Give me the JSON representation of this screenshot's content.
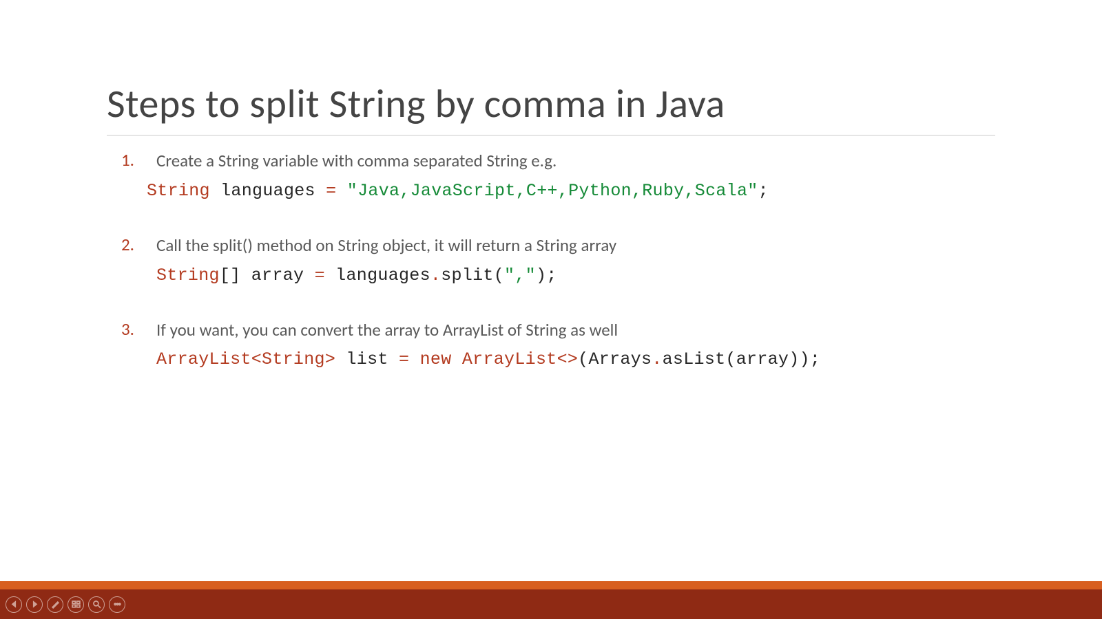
{
  "slide": {
    "title": "Steps to split String by comma in Java",
    "steps": [
      {
        "num": "1.",
        "text": "Create a String variable with comma separated String e.g.",
        "code": {
          "seg1_type": "String",
          "seg2_plain": " languages ",
          "seg3_op": "=",
          "seg4_plain": " ",
          "seg5_str": "\"Java,JavaScript,C++,Python,Ruby,Scala\"",
          "seg6_plain": ";"
        }
      },
      {
        "num": "2.",
        "text": "Call the split() method on String object, it will return a String array",
        "code": {
          "seg1_type": "String",
          "seg2_plain": "[] array ",
          "seg3_op": "=",
          "seg4_plain": " languages",
          "seg5_op": ".",
          "seg6_plain": "split(",
          "seg7_str": "\",\"",
          "seg8_plain": ");"
        }
      },
      {
        "num": "3.",
        "text": "If you want, you can convert the array to ArrayList of String as well",
        "code": {
          "seg1_type": "ArrayList<String>",
          "seg2_plain": " list ",
          "seg3_op": "=",
          "seg4_plain": " ",
          "seg5_kw": "new",
          "seg6_plain": " ",
          "seg7_type": "ArrayList<>",
          "seg8_plain": "(Arrays",
          "seg9_op": ".",
          "seg10_plain": "asList(array));"
        }
      }
    ]
  },
  "controls": {
    "prev": "prev",
    "next": "next",
    "pen": "pen",
    "view": "view",
    "zoom": "zoom",
    "more": "more"
  }
}
